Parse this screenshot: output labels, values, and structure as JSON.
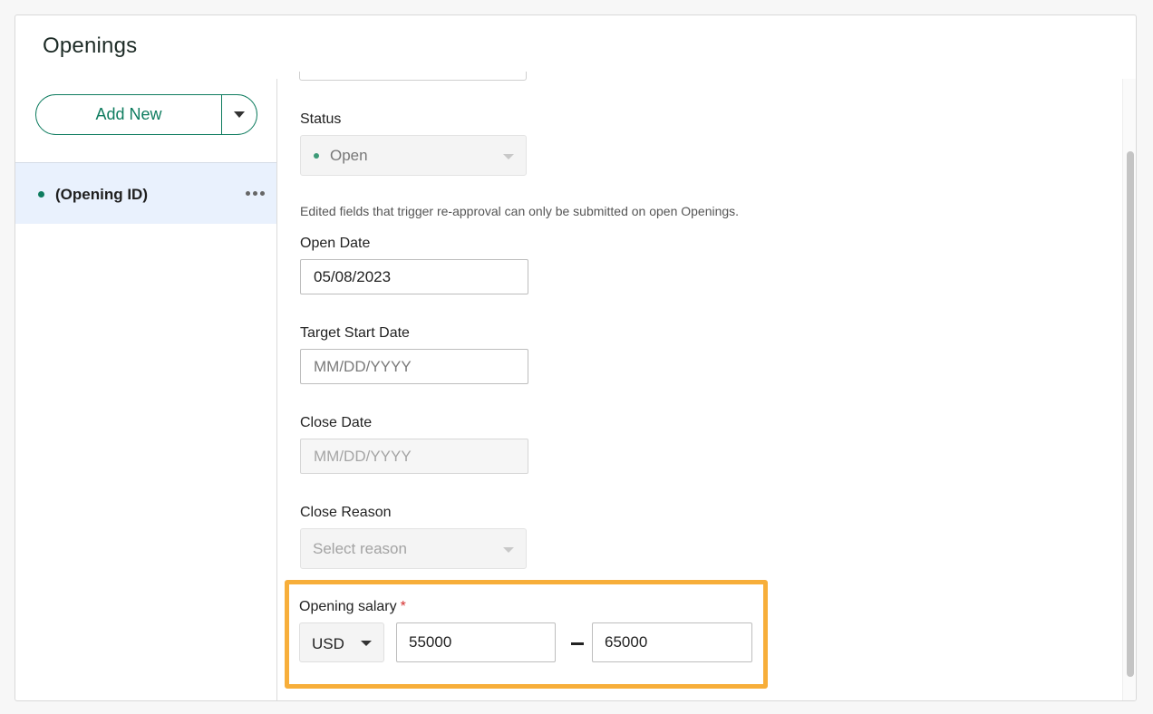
{
  "panel": {
    "title": "Openings"
  },
  "left": {
    "add_new_label": "Add New",
    "opening_item_label": "(Opening ID)"
  },
  "form": {
    "status": {
      "label": "Status",
      "value": "Open",
      "help": "Edited fields that trigger re-approval can only be submitted on open Openings."
    },
    "open_date": {
      "label": "Open Date",
      "value": "05/08/2023"
    },
    "target_start_date": {
      "label": "Target Start Date",
      "placeholder": "MM/DD/YYYY"
    },
    "close_date": {
      "label": "Close Date",
      "placeholder": "MM/DD/YYYY"
    },
    "close_reason": {
      "label": "Close Reason",
      "placeholder": "Select reason"
    },
    "salary": {
      "label": "Opening salary",
      "required_mark": "*",
      "currency": "USD",
      "min": "55000",
      "max": "65000"
    }
  },
  "colors": {
    "accent": "#0e7c5f",
    "highlight": "#f7ae3a",
    "required": "#d4302f"
  },
  "icons": [
    "caret-down-icon",
    "more-horizontal-icon",
    "status-dot-icon"
  ]
}
